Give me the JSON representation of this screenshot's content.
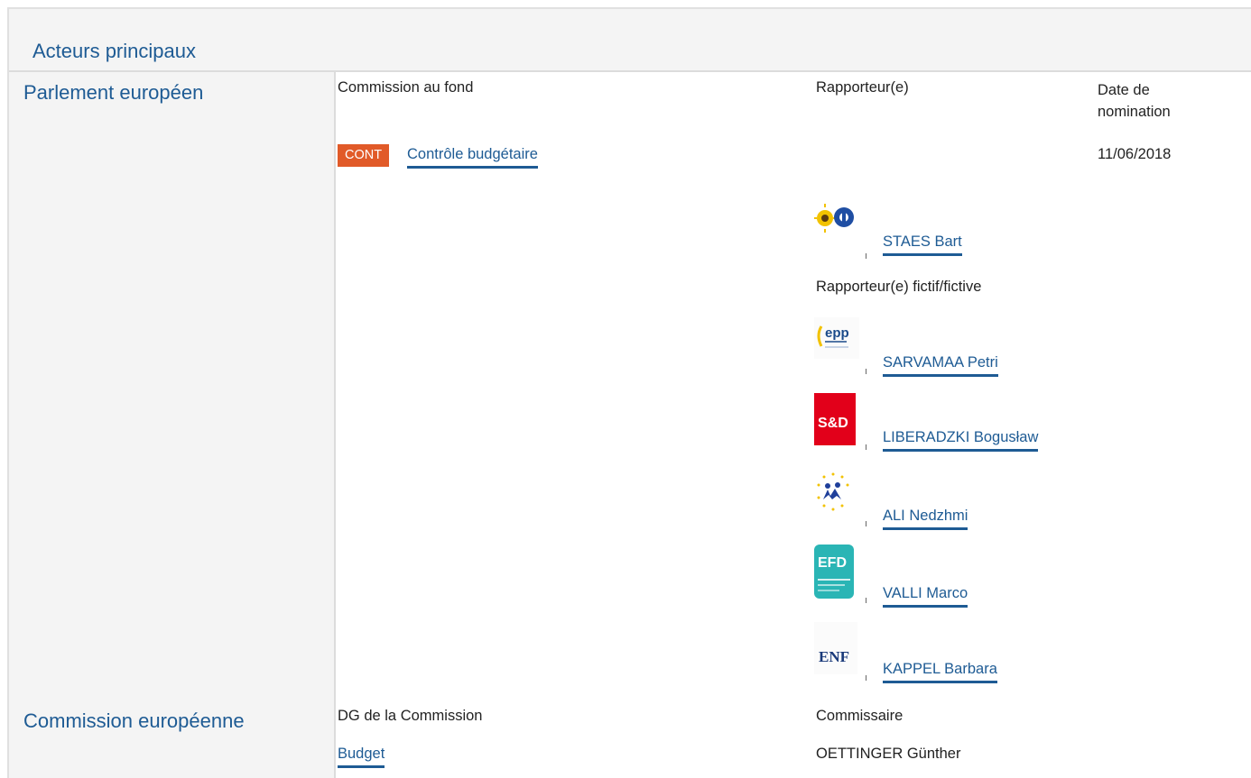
{
  "header": {
    "title": "Acteurs principaux"
  },
  "parliament": {
    "label": "Parlement européen",
    "col_committee": "Commission au fond",
    "col_rapporteur": "Rapporteur(e)",
    "col_date": "Date de nomination",
    "committee_code": "CONT",
    "committee_name": "Contrôle budgétaire",
    "date": "11/06/2018",
    "rapporteur": {
      "name": "STAES Bart",
      "group_icon": "greens-efa-logo"
    },
    "shadow_label": "Rapporteur(e) fictif/fictive",
    "shadows": [
      {
        "name": "SARVAMAA Petri",
        "group_icon": "epp-logo",
        "logo_text": "epp"
      },
      {
        "name": "LIBERADZKI Bogusław",
        "group_icon": "s-and-d-logo",
        "logo_text": "S&D"
      },
      {
        "name": "ALI Nedzhmi",
        "group_icon": "alde-logo"
      },
      {
        "name": "VALLI Marco",
        "group_icon": "efdd-logo",
        "logo_text": "EFD"
      },
      {
        "name": "KAPPEL Barbara",
        "group_icon": "enf-logo",
        "logo_text": "ENF"
      }
    ]
  },
  "commission": {
    "label": "Commission européenne",
    "col_dg": "DG de la Commission",
    "col_commissioner": "Commissaire",
    "dg": "Budget",
    "commissioner": "OETTINGER Günther"
  },
  "colors": {
    "link": "#1e5b94",
    "badge": "#e15a28",
    "panel": "#f4f4f4",
    "sd_red": "#e2001a",
    "efdd_teal": "#2ab5b5",
    "enf_navy": "#1a3a7a"
  }
}
